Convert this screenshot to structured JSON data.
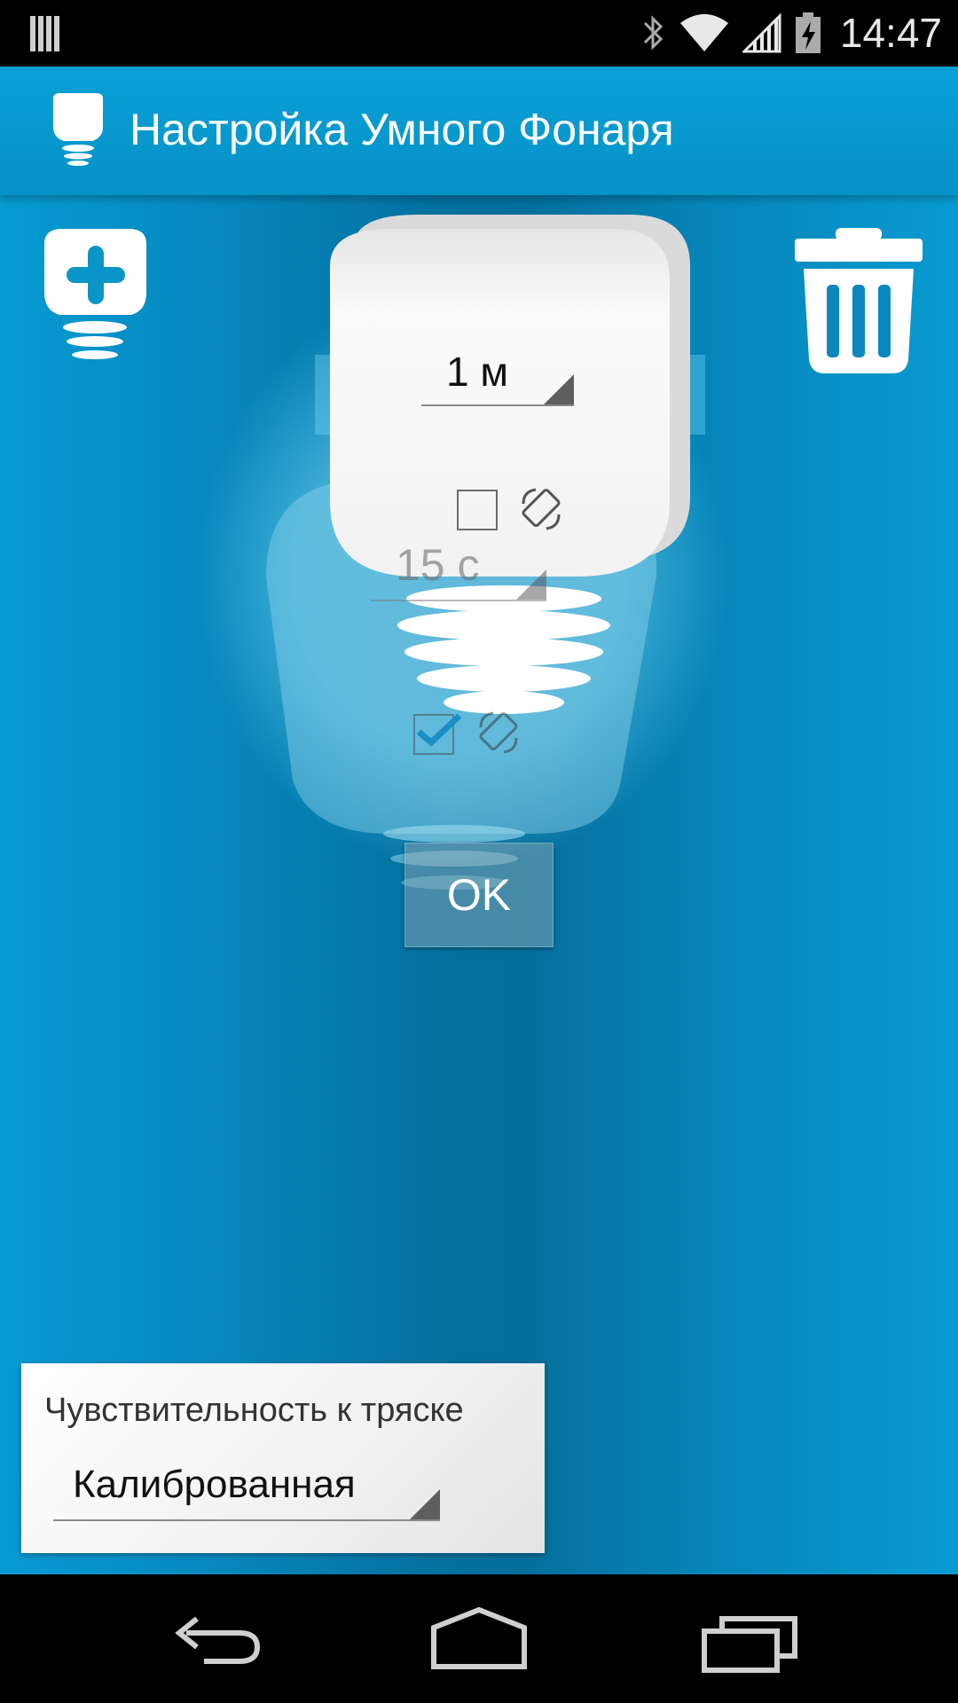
{
  "status_bar": {
    "time": "14:47",
    "icons": [
      "notification-bars-icon",
      "bluetooth-icon",
      "wifi-icon",
      "signal-icon",
      "battery-charging-icon"
    ]
  },
  "action_bar": {
    "title": "Настройка Умного Фонаря",
    "icon": "bulb-icon"
  },
  "toolbar": {
    "add_icon": "add-bulb-icon",
    "delete_icon": "trash-icon"
  },
  "front_card": {
    "duration_value": "1 м",
    "checkbox_checked": false
  },
  "back_card": {
    "duration_value": "15 с",
    "checkbox_checked": true
  },
  "ok_label": "OK",
  "shake": {
    "label": "Чувствительность к тряске",
    "value": "Калиброванная"
  },
  "nav_bar": {
    "icons": [
      "back-icon",
      "home-icon",
      "recent-apps-icon"
    ]
  },
  "colors": {
    "accent": "#0aa0d6",
    "background_dark": "#04719f",
    "checkbox_check": "#1a8fc6"
  }
}
